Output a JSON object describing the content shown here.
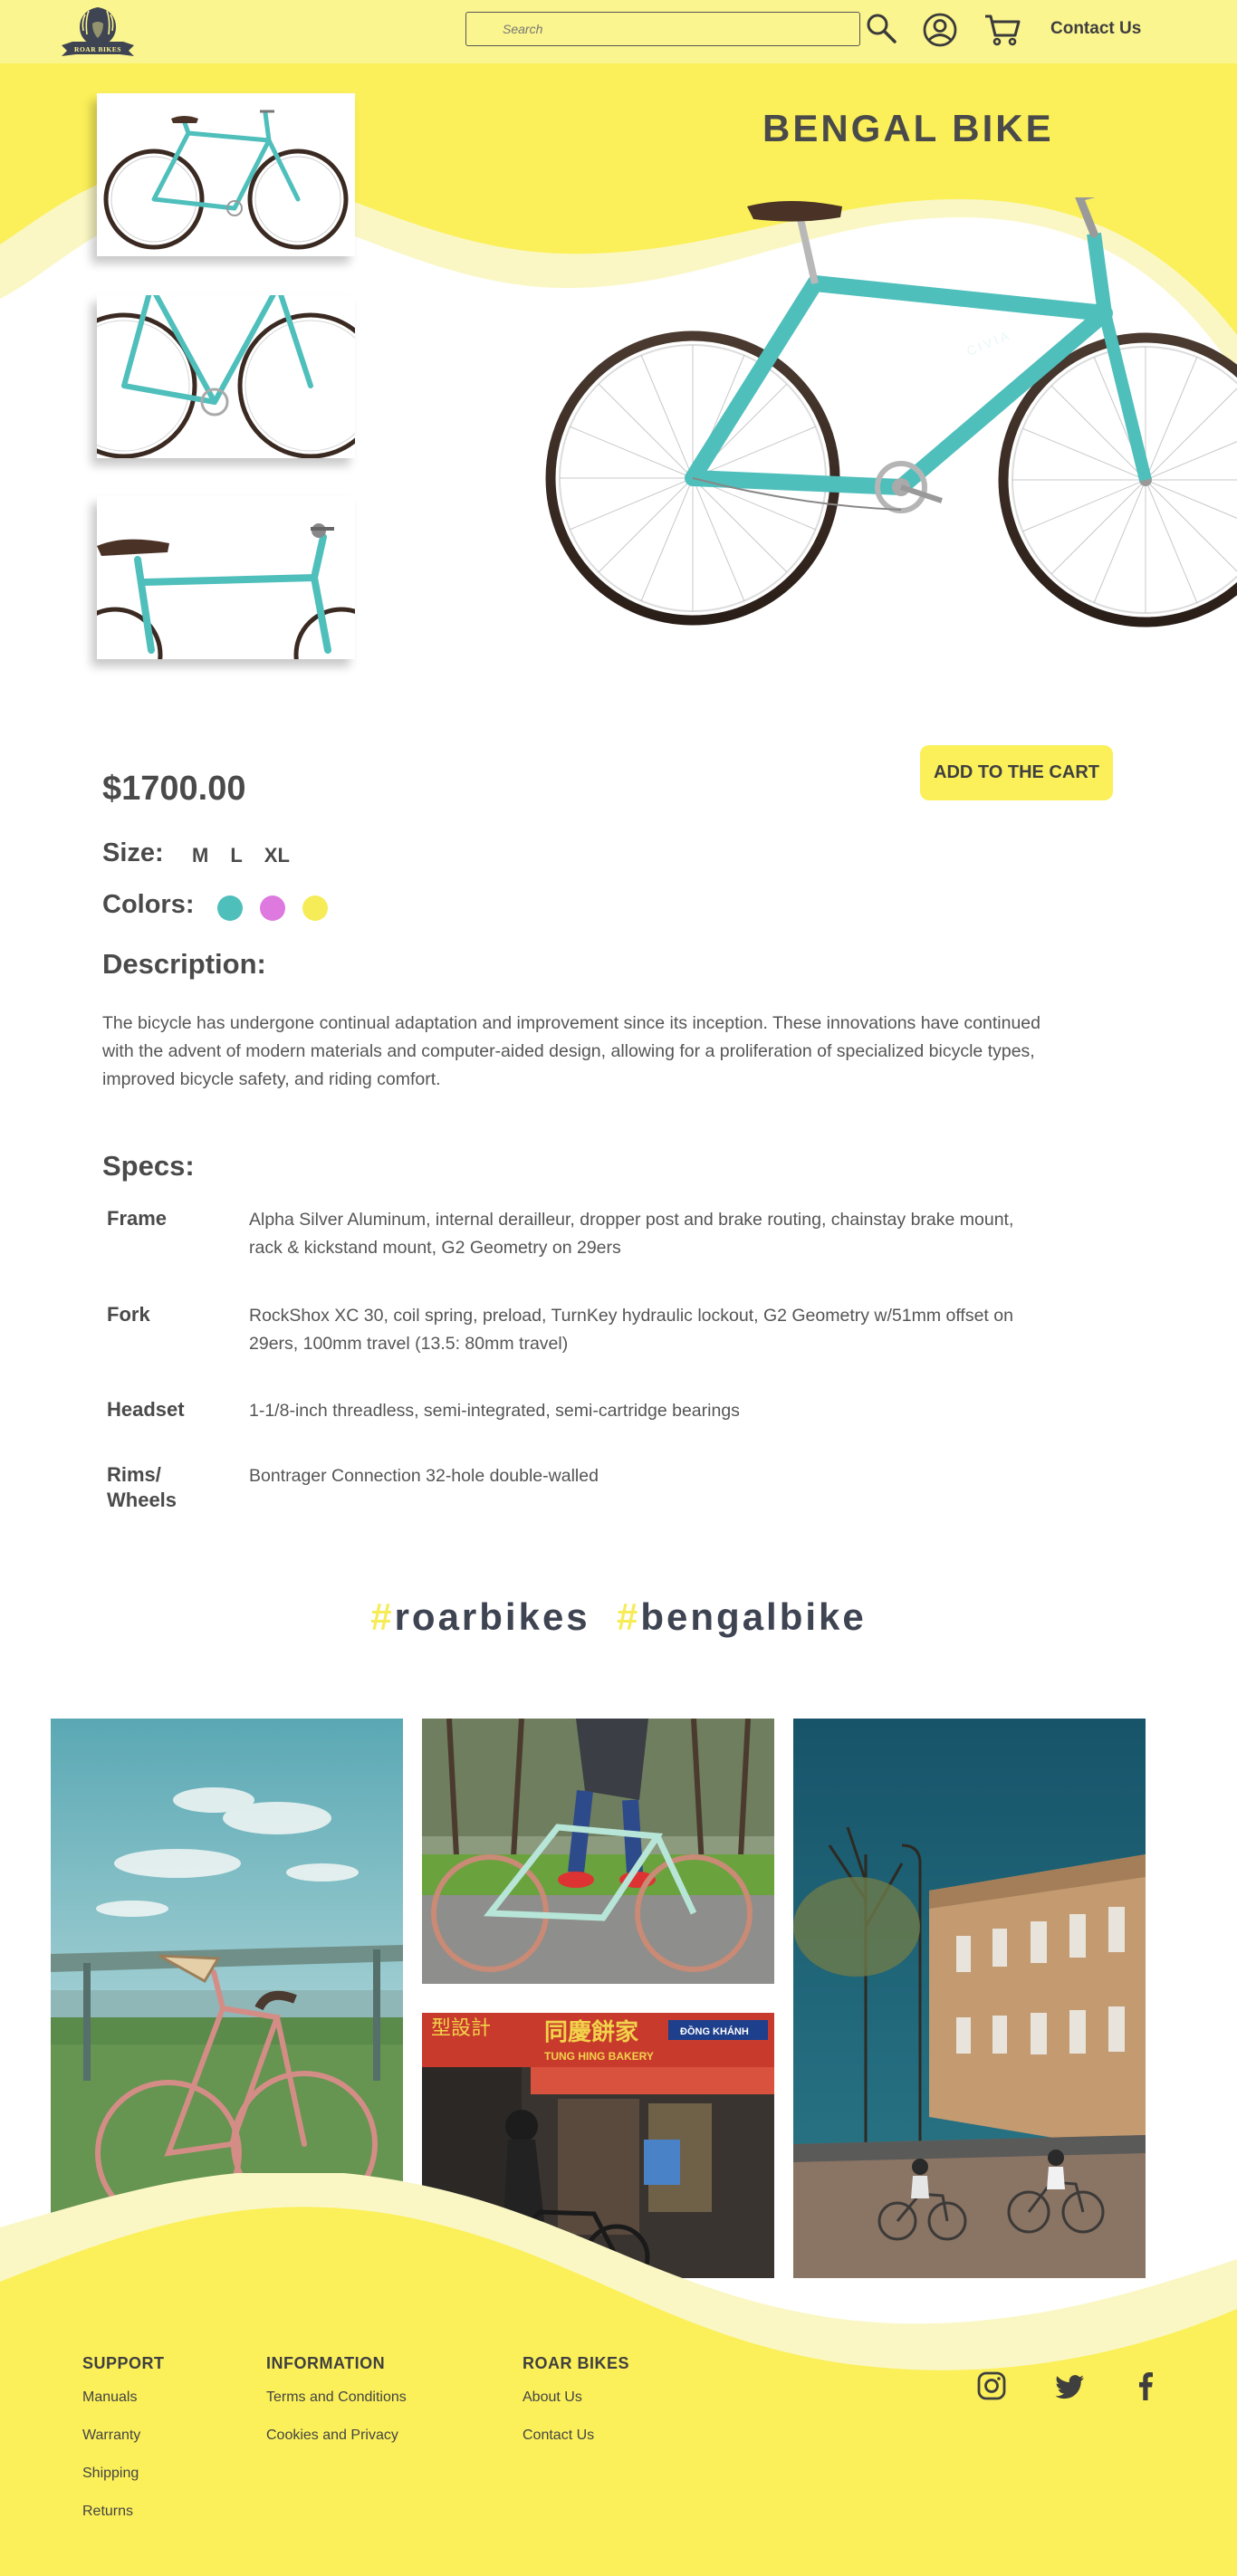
{
  "header": {
    "logo_text": "ROAR BIKES",
    "search_placeholder": "Search",
    "contact_label": "Contact Us"
  },
  "product": {
    "title": "BENGAL BIKE",
    "price": "$1700.00",
    "add_to_cart_label": "ADD TO THE CART",
    "size_label": "Size:",
    "sizes": [
      "M",
      "L",
      "XL"
    ],
    "colors_label": "Colors:",
    "colors": [
      "#4fbfbc",
      "#de7adf",
      "#f6ec57"
    ],
    "description_title": "Description:",
    "description": "The bicycle has undergone continual adaptation and improvement since its inception. These innovations have continued with the advent of modern materials and computer-aided design, allowing for a proliferation of specialized bicycle types, improved bicycle safety, and riding comfort.",
    "specs_title": "Specs:",
    "specs": [
      {
        "name": "Frame",
        "value": "Alpha Silver Aluminum, internal derailleur, dropper post and brake routing, chainstay brake mount, rack & kickstand mount, G2 Geometry on 29ers"
      },
      {
        "name": "Fork",
        "value": "RockShox XC 30, coil spring, preload, TurnKey hydraulic lockout, G2 Geometry w/51mm offset on 29ers, 100mm travel (13.5: 80mm travel)"
      },
      {
        "name": "Headset",
        "value": "1-1/8-inch threadless, semi-integrated, semi-cartridge bearings"
      },
      {
        "name": "Rims/ Wheels",
        "value": "Bontrager Connection 32-hole double-walled"
      }
    ]
  },
  "social_tags": {
    "hash": "#",
    "tag1": "roarbikes",
    "tag2": "bengalbike"
  },
  "gallery": {
    "sign_text_1": "同慶餅家",
    "sign_text_2": "TUNG HING BAKERY",
    "sign_text_3": "ĐỒNG KHÁNH",
    "sign_text_4": "型設計"
  },
  "footer": {
    "support": {
      "title": "SUPPORT",
      "links": [
        "Manuals",
        "Warranty",
        "Shipping",
        "Returns"
      ]
    },
    "information": {
      "title": "INFORMATION",
      "links": [
        "Terms and Conditions",
        "Cookies and Privacy"
      ]
    },
    "roar_bikes": {
      "title": "ROAR BIKES",
      "links": [
        "About Us",
        "Contact Us"
      ]
    },
    "social_icons": [
      "instagram-icon",
      "twitter-icon",
      "facebook-icon"
    ]
  },
  "colors": {
    "brand_yellow": "#fbf059",
    "header_yellow": "#fbf58f",
    "bike_teal": "#4fbfbc",
    "text_dark": "#4a4a4a"
  }
}
